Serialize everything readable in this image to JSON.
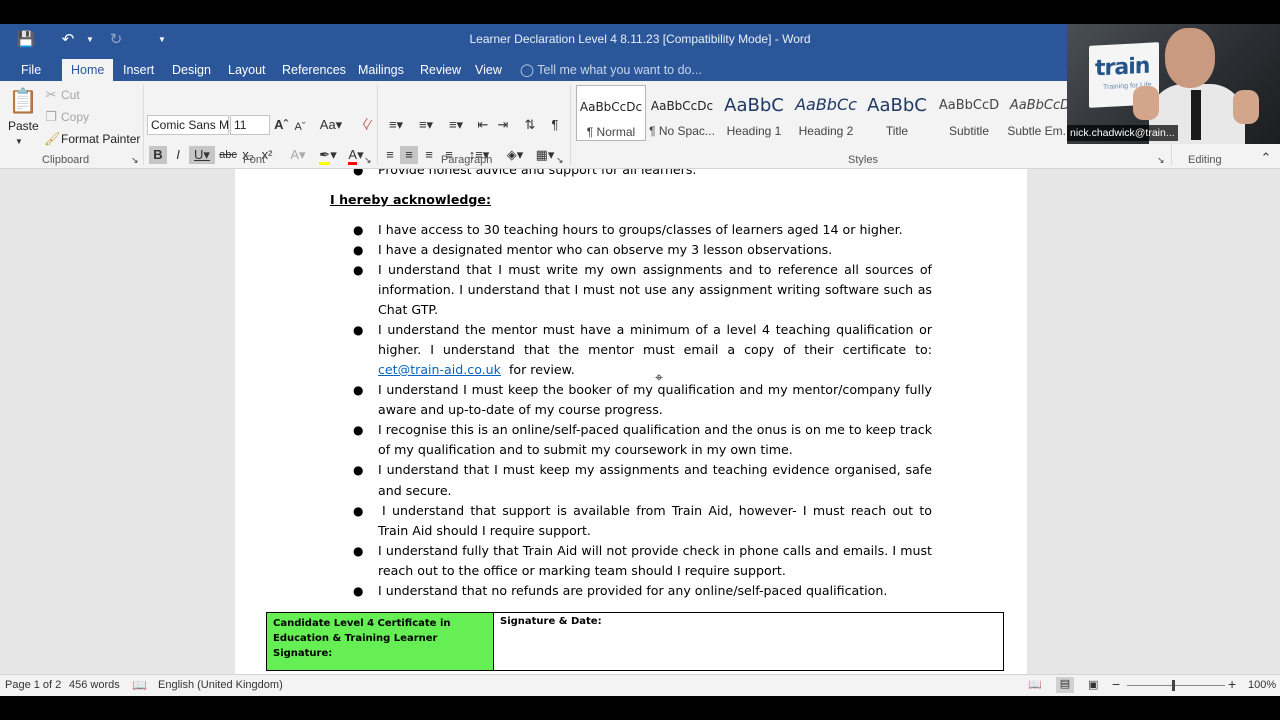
{
  "window": {
    "title": "Learner Declaration Level 4 8.11.23 [Compatibility Mode] - Word"
  },
  "tabs": [
    "File",
    "Home",
    "Insert",
    "Design",
    "Layout",
    "References",
    "Mailings",
    "Review",
    "View"
  ],
  "active_tab": "Home",
  "tell_me": "Tell me what you want to do...",
  "ribbon": {
    "clipboard": {
      "label": "Clipboard",
      "paste": "Paste",
      "cut": "Cut",
      "copy": "Copy",
      "format_painter": "Format Painter"
    },
    "font": {
      "label": "Font",
      "font_name": "Comic Sans M",
      "font_size": "11"
    },
    "paragraph": {
      "label": "Paragraph"
    },
    "styles": {
      "label": "Styles",
      "items": [
        {
          "preview": "AaBbCcDc",
          "name": "¶ Normal"
        },
        {
          "preview": "AaBbCcDc",
          "name": "¶ No Spac..."
        },
        {
          "preview": "AaBbC",
          "name": "Heading 1"
        },
        {
          "preview": "AaBbCc",
          "name": "Heading 2"
        },
        {
          "preview": "AaBbC",
          "name": "Title"
        },
        {
          "preview": "AaBbCcD",
          "name": "Subtitle"
        },
        {
          "preview": "AaBbCcD",
          "name": "Subtle Em..."
        }
      ]
    },
    "editing": {
      "label": "Editing"
    }
  },
  "document": {
    "partial_top_line": "Provide honest advice and support for all learners.",
    "heading": "I hereby acknowledge:",
    "lines": {
      "b1": "I have access to 30 teaching hours to groups/classes of learners aged 14 or higher.",
      "b2": "I have a designated mentor who can observe my 3 lesson observations.",
      "b3a": "I understand that I must write my own assignments and to reference all sources of",
      "b3b": "information. I understand that I must not use any assignment writing software such as",
      "b3c": "Chat GTP.",
      "b4a": "I understand the mentor must have a minimum of a level 4 teaching qualification or",
      "b4b": "higher. I understand that the mentor must email a copy of their certificate to:",
      "b4c_link": "cet@train-aid.co.uk",
      "b4c_rest": "for review.",
      "b5a": "I understand I must keep the booker of my qualification and my mentor/company fully",
      "b5b": "aware and up-to-date of my course progress.",
      "b6a": "I recognise this is an online/self-paced qualification and the onus is on me to keep track",
      "b6b": "of my qualification and to submit my coursework in my own time.",
      "b7a": "I understand that I must keep my assignments and teaching evidence organised, safe",
      "b7b": "and secure.",
      "b8a": "I understand that support is available from Train Aid, however- I must reach out to",
      "b8b": "Train Aid should I require support.",
      "b9a": "I understand fully that Train Aid will not provide check in phone calls and emails. I must",
      "b9b": "reach out to the office or marking team should I require support.",
      "b10": "I understand that no refunds are provided for any online/self-paced qualification."
    },
    "signature_table": {
      "left_line1": "Candidate Level 4 Certificate in",
      "left_line2": "Education & Training Learner Signature:",
      "right": "Signature & Date:"
    }
  },
  "status_bar": {
    "page": "Page 1 of 2",
    "words": "456 words",
    "language": "English (United Kingdom)",
    "zoom": "100%"
  },
  "webcam": {
    "name": "nick.chadwick@train...",
    "logo_text": "train",
    "logo_sub": "Training for Life"
  },
  "colors": {
    "word_blue": "#2b579a",
    "link_blue": "#0563c1",
    "signature_green": "#66ee55"
  }
}
